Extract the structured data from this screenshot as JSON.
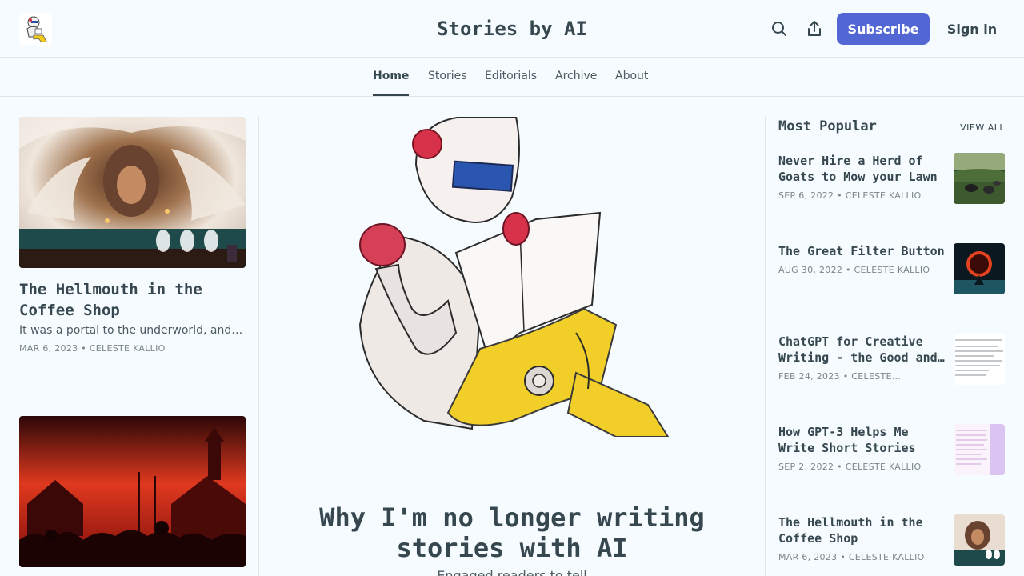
{
  "header": {
    "title": "Stories by AI",
    "logo_icon": "robot-reading-logo",
    "search_icon": "search-icon",
    "share_icon": "share-icon",
    "subscribe_label": "Subscribe",
    "signin_label": "Sign in",
    "accent_color": "#5266d4"
  },
  "nav": {
    "items": [
      {
        "label": "Home",
        "active": true
      },
      {
        "label": "Stories"
      },
      {
        "label": "Editorials"
      },
      {
        "label": "Archive"
      },
      {
        "label": "About"
      }
    ]
  },
  "left": {
    "posts": [
      {
        "title": "The Hellmouth in the Coffee Shop",
        "subtitle": "It was a portal to the underworld, and…",
        "meta": "MAR 6, 2023 • CELESTE KALLIO"
      },
      {
        "title": "",
        "subtitle": "",
        "meta": ""
      }
    ]
  },
  "featured": {
    "title": "Why I'm no longer writing stories with AI",
    "subtitle": "Engaged readers to tell"
  },
  "popular": {
    "heading": "Most Popular",
    "view_all": "VIEW ALL",
    "items": [
      {
        "title": "Never Hire a Herd of Goats to Mow your Lawn",
        "meta": "SEP 6, 2022 • CELESTE KALLIO"
      },
      {
        "title": "The Great Filter Button",
        "meta": "AUG 30, 2022 • CELESTE KALLIO"
      },
      {
        "title": "ChatGPT for Creative Writing - the Good and the Bad",
        "meta": "FEB 24, 2023 • CELESTE…"
      },
      {
        "title": "How GPT-3 Helps Me Write Short Stories",
        "meta": "SEP 2, 2022 • CELESTE KALLIO"
      },
      {
        "title": "The Hellmouth in the Coffee Shop",
        "meta": "MAR 6, 2023 • CELESTE KALLIO"
      }
    ]
  }
}
